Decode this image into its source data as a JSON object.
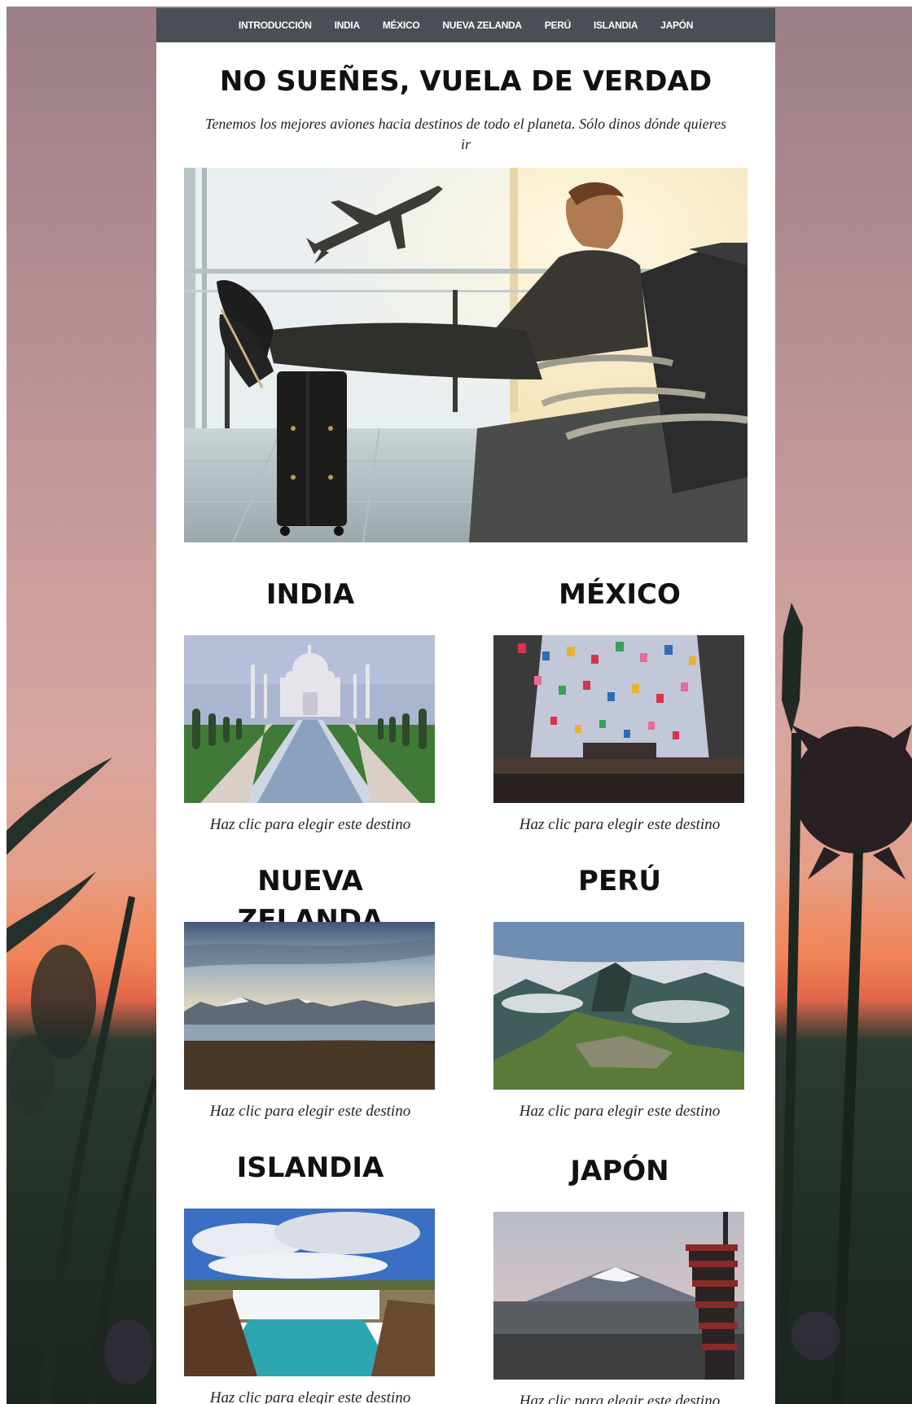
{
  "nav": {
    "items": [
      {
        "label": "INTRODUCCIÓN"
      },
      {
        "label": "INDIA"
      },
      {
        "label": "MÉXICO"
      },
      {
        "label": "NUEVA ZELANDA"
      },
      {
        "label": "PERÚ"
      },
      {
        "label": "ISLANDIA"
      },
      {
        "label": "JAPÓN"
      }
    ]
  },
  "hero": {
    "title": "NO SUEÑES, VUELA DE VERDAD",
    "subtitle": "Tenemos los mejores aviones hacia destinos de todo el planeta. Sólo dinos dónde quieres ir"
  },
  "destinations": [
    {
      "title": "INDIA",
      "caption": "Haz clic para elegir este destino"
    },
    {
      "title": "MÉXICO",
      "caption": "Haz clic para elegir este destino"
    },
    {
      "title": "NUEVA ZELANDA",
      "caption": "Haz clic para elegir este destino"
    },
    {
      "title": "PERÚ",
      "caption": "Haz clic para elegir este destino"
    },
    {
      "title": "ISLANDIA",
      "caption": "Haz clic para elegir este destino"
    },
    {
      "title": "JAPÓN",
      "caption": "Haz clic para elegir este destino"
    }
  ],
  "colors": {
    "nav_bg": "#4a4e55",
    "panel_bg": "#ffffff",
    "text": "#111111"
  }
}
